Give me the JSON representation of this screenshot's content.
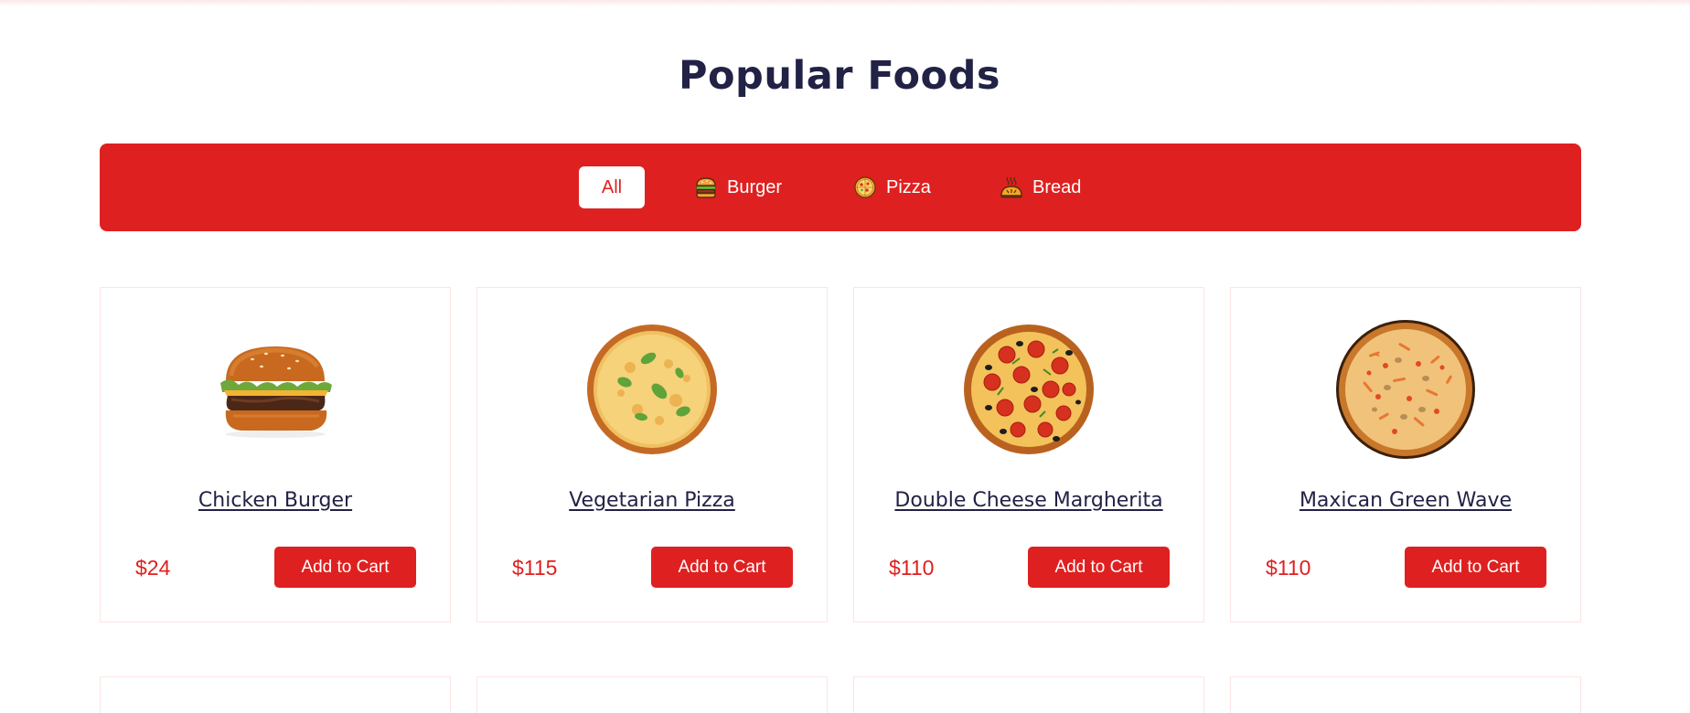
{
  "section": {
    "title": "Popular Foods"
  },
  "filters": [
    {
      "label": "All",
      "active": true,
      "icon": ""
    },
    {
      "label": "Burger",
      "active": false,
      "icon": "burger-icon"
    },
    {
      "label": "Pizza",
      "active": false,
      "icon": "pizza-icon"
    },
    {
      "label": "Bread",
      "active": false,
      "icon": "bread-icon"
    }
  ],
  "products": [
    {
      "name": "Chicken Burger",
      "price": "$24",
      "cta": "Add to Cart",
      "image": "burger"
    },
    {
      "name": "Vegetarian Pizza",
      "price": "$115",
      "cta": "Add to Cart",
      "image": "veg-pizza"
    },
    {
      "name": "Double Cheese Margherita",
      "price": "$110",
      "cta": "Add to Cart",
      "image": "pepperoni-pizza"
    },
    {
      "name": "Maxican Green Wave",
      "price": "$110",
      "cta": "Add to Cart",
      "image": "mixed-pizza"
    }
  ],
  "colors": {
    "accent": "#df2020",
    "heading": "#212245",
    "card_border": "#fde4e4"
  }
}
